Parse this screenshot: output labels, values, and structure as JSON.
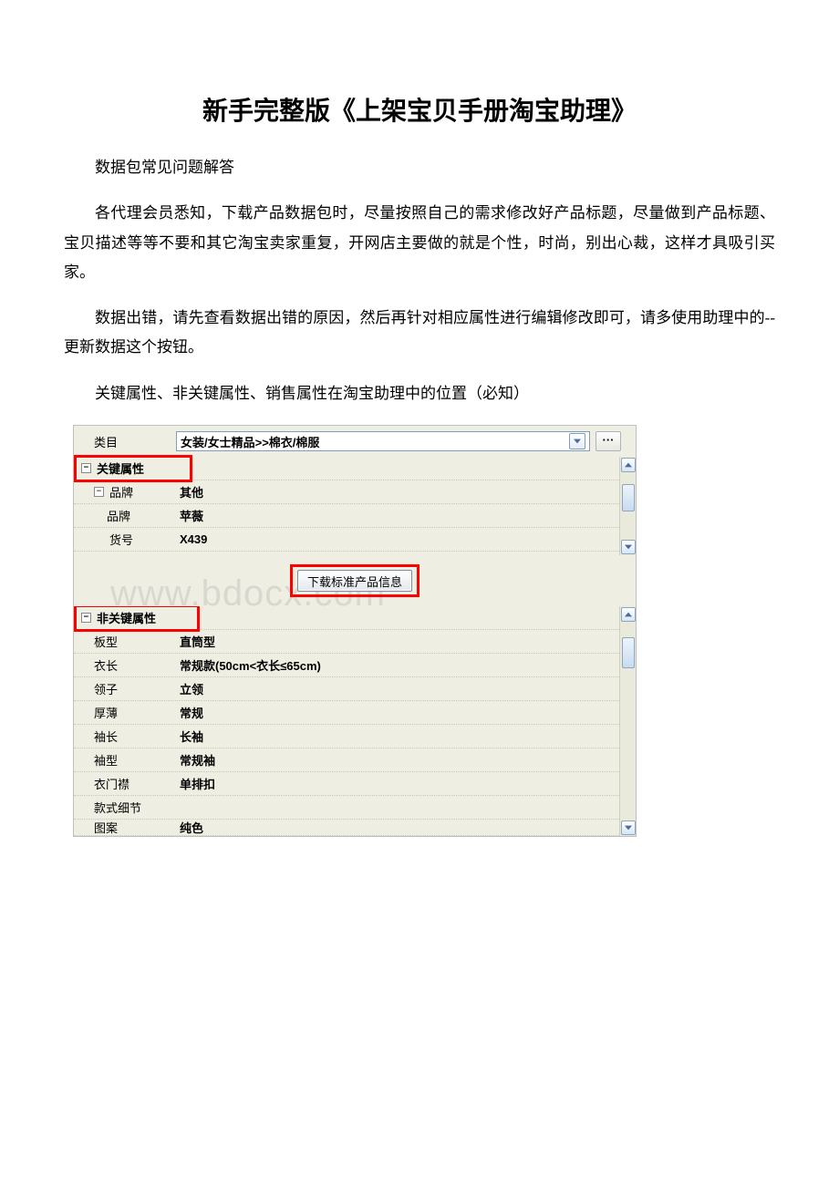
{
  "title": "新手完整版《上架宝贝手册淘宝助理》",
  "paragraphs": {
    "p1": "数据包常见问题解答",
    "p2": "各代理会员悉知，下载产品数据包时，尽量按照自己的需求修改好产品标题，尽量做到产品标题、宝贝描述等等不要和其它淘宝卖家重复，开网店主要做的就是个性，时尚，别出心裁，这样才具吸引买家。",
    "p3": "数据出错，请先查看数据出错的原因，然后再针对相应属性进行编辑修改即可，请多使用助理中的--更新数据这个按钮。",
    "p4": "关键属性、非关键属性、销售属性在淘宝助理中的位置（必知）"
  },
  "ui": {
    "category_label": "类目",
    "category_value": "女装/女士精品>>棉衣/棉服",
    "more_button": "···",
    "download_button": "下载标准产品信息",
    "watermark": "www.bdocx.com",
    "section_key": "关键属性",
    "section_nonkey": "非关键属性",
    "key_rows": [
      {
        "label": "品牌",
        "value": "其他",
        "toggle": true
      },
      {
        "label": "品牌",
        "value": "苹薇",
        "toggle": false,
        "indent": true
      },
      {
        "label": "货号",
        "value": "X439",
        "toggle": false
      }
    ],
    "nonkey_rows": [
      {
        "label": "板型",
        "value": "直筒型"
      },
      {
        "label": "衣长",
        "value": "常规款(50cm<衣长≤65cm)"
      },
      {
        "label": "领子",
        "value": "立领"
      },
      {
        "label": "厚薄",
        "value": "常规"
      },
      {
        "label": "袖长",
        "value": "长袖"
      },
      {
        "label": "袖型",
        "value": "常规袖"
      },
      {
        "label": "衣门襟",
        "value": "单排扣"
      },
      {
        "label": "款式细节",
        "value": ""
      },
      {
        "label": "图案",
        "value": "纯色"
      }
    ]
  }
}
